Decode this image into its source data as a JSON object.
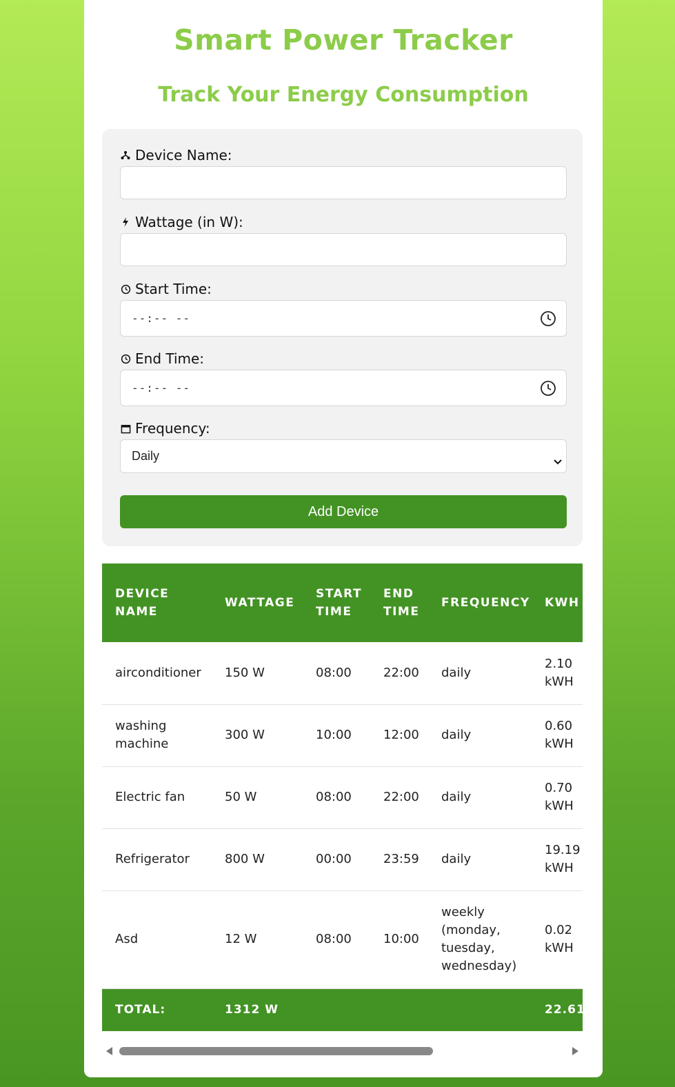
{
  "app": {
    "title": "Smart Power Tracker",
    "subtitle": "Track Your Energy Consumption"
  },
  "form": {
    "device_name_label": "Device Name:",
    "device_name_value": "",
    "wattage_label": "Wattage (in W):",
    "wattage_value": "",
    "start_time_label": "Start Time:",
    "start_time_value": "--:-- --",
    "end_time_label": "End Time:",
    "end_time_value": "--:-- --",
    "frequency_label": "Frequency:",
    "frequency_value": "Daily",
    "add_button": "Add Device"
  },
  "table": {
    "headers": [
      "DEVICE NAME",
      "WATTAGE",
      "START TIME",
      "END TIME",
      "FREQUENCY",
      "KWH"
    ],
    "rows": [
      {
        "name": "airconditioner",
        "wattage": "150 W",
        "start": "08:00",
        "end": "22:00",
        "frequency": "daily",
        "kwh": "2.10 kWH"
      },
      {
        "name": "washing machine",
        "wattage": "300 W",
        "start": "10:00",
        "end": "12:00",
        "frequency": "daily",
        "kwh": "0.60 kWH"
      },
      {
        "name": "Electric fan",
        "wattage": "50 W",
        "start": "08:00",
        "end": "22:00",
        "frequency": "daily",
        "kwh": "0.70 kWH"
      },
      {
        "name": "Refrigerator",
        "wattage": "800 W",
        "start": "00:00",
        "end": "23:59",
        "frequency": "daily",
        "kwh": "19.19 kWH"
      },
      {
        "name": "Asd",
        "wattage": "12 W",
        "start": "08:00",
        "end": "10:00",
        "frequency": "weekly (monday, tuesday, wednesday)",
        "kwh": "0.02 kWH"
      }
    ],
    "total_label": "TOTAL:",
    "total_wattage": "1312 W",
    "total_kwh": "22.61"
  },
  "colors": {
    "accent": "#439324",
    "title": "#8ccc4a"
  },
  "icons": {
    "device": "device-network-icon",
    "wattage": "bolt-icon",
    "start_time": "clock-icon",
    "end_time": "clock-icon",
    "frequency": "calendar-icon"
  }
}
